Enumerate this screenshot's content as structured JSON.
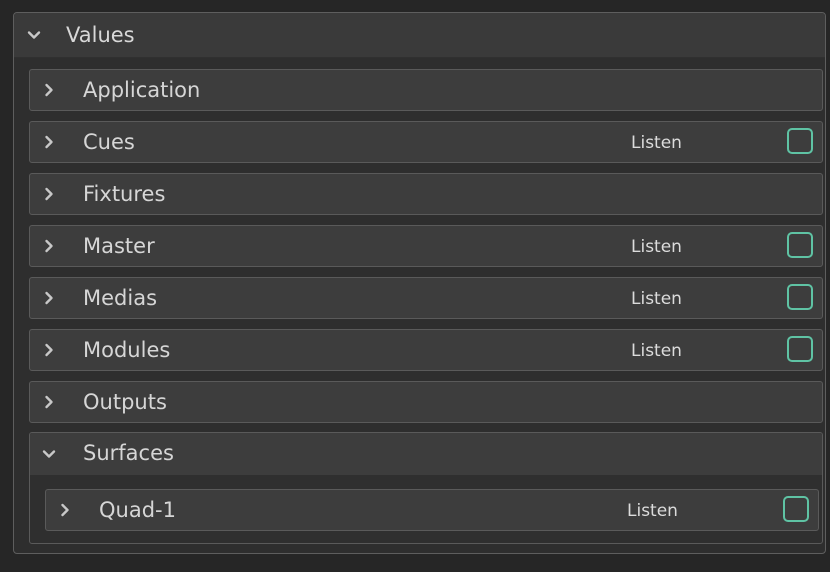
{
  "panel": {
    "title": "Values",
    "expanded": true,
    "accent_color": "#5fc3a4",
    "items": [
      {
        "label": "Application",
        "expanded": false
      },
      {
        "label": "Cues",
        "expanded": false,
        "listen_label": "Listen",
        "listen_checked": false
      },
      {
        "label": "Fixtures",
        "expanded": false
      },
      {
        "label": "Master",
        "expanded": false,
        "listen_label": "Listen",
        "listen_checked": false
      },
      {
        "label": "Medias",
        "expanded": false,
        "listen_label": "Listen",
        "listen_checked": false
      },
      {
        "label": "Modules",
        "expanded": false,
        "listen_label": "Listen",
        "listen_checked": false
      },
      {
        "label": "Outputs",
        "expanded": false
      }
    ],
    "surfaces": {
      "label": "Surfaces",
      "expanded": true,
      "children": [
        {
          "label": "Quad-1",
          "expanded": false,
          "listen_label": "Listen",
          "listen_checked": false
        }
      ]
    }
  }
}
